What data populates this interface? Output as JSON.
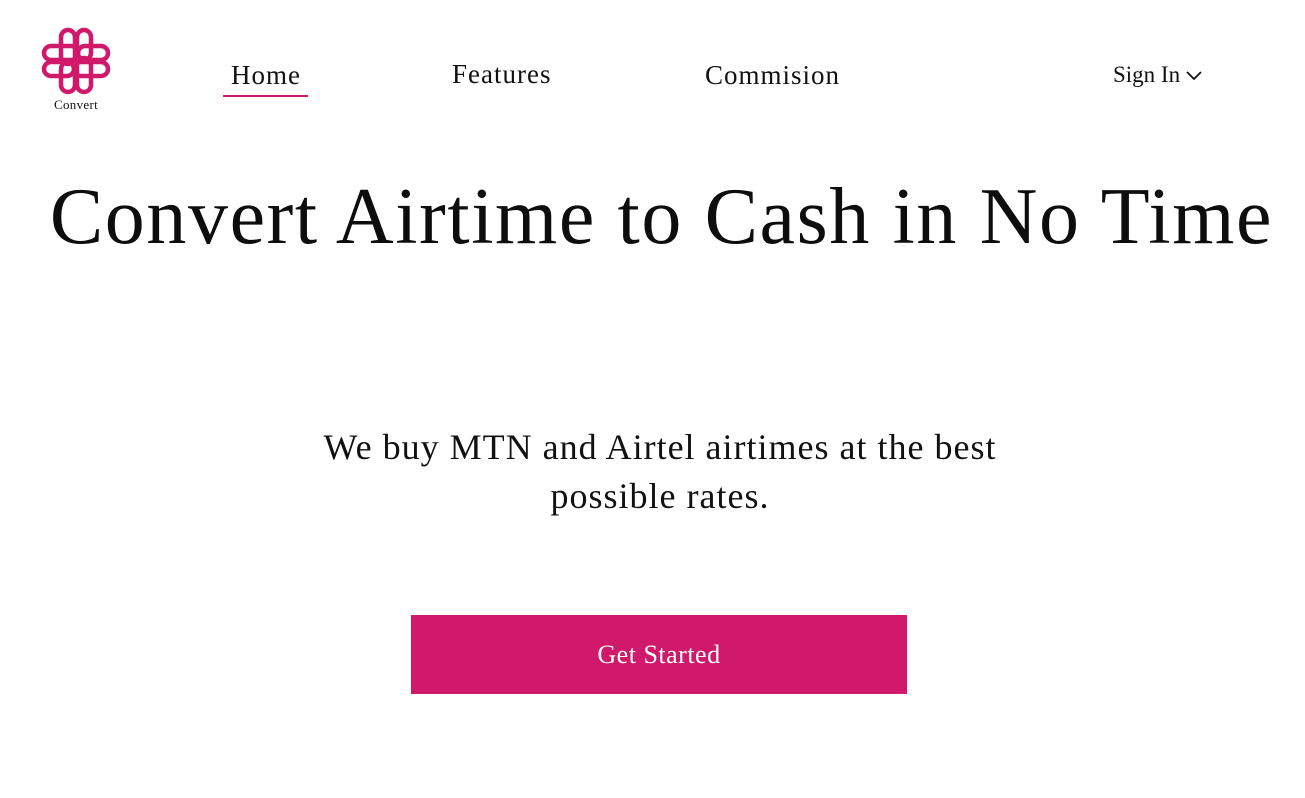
{
  "brand": {
    "name": "Convert",
    "logo_icon": "clover-logo-icon",
    "accent_color": "#d0196a"
  },
  "nav": {
    "items": [
      {
        "label": "Home",
        "active": true
      },
      {
        "label": "Features",
        "active": false
      },
      {
        "label": "Commision",
        "active": false
      }
    ],
    "signin_label": "Sign In",
    "signin_icon": "chevron-down-icon"
  },
  "hero": {
    "title": "Convert Airtime to Cash in No Time",
    "subtitle": "We buy MTN and Airtel airtimes at the best possible rates.",
    "cta_label": "Get Started"
  }
}
